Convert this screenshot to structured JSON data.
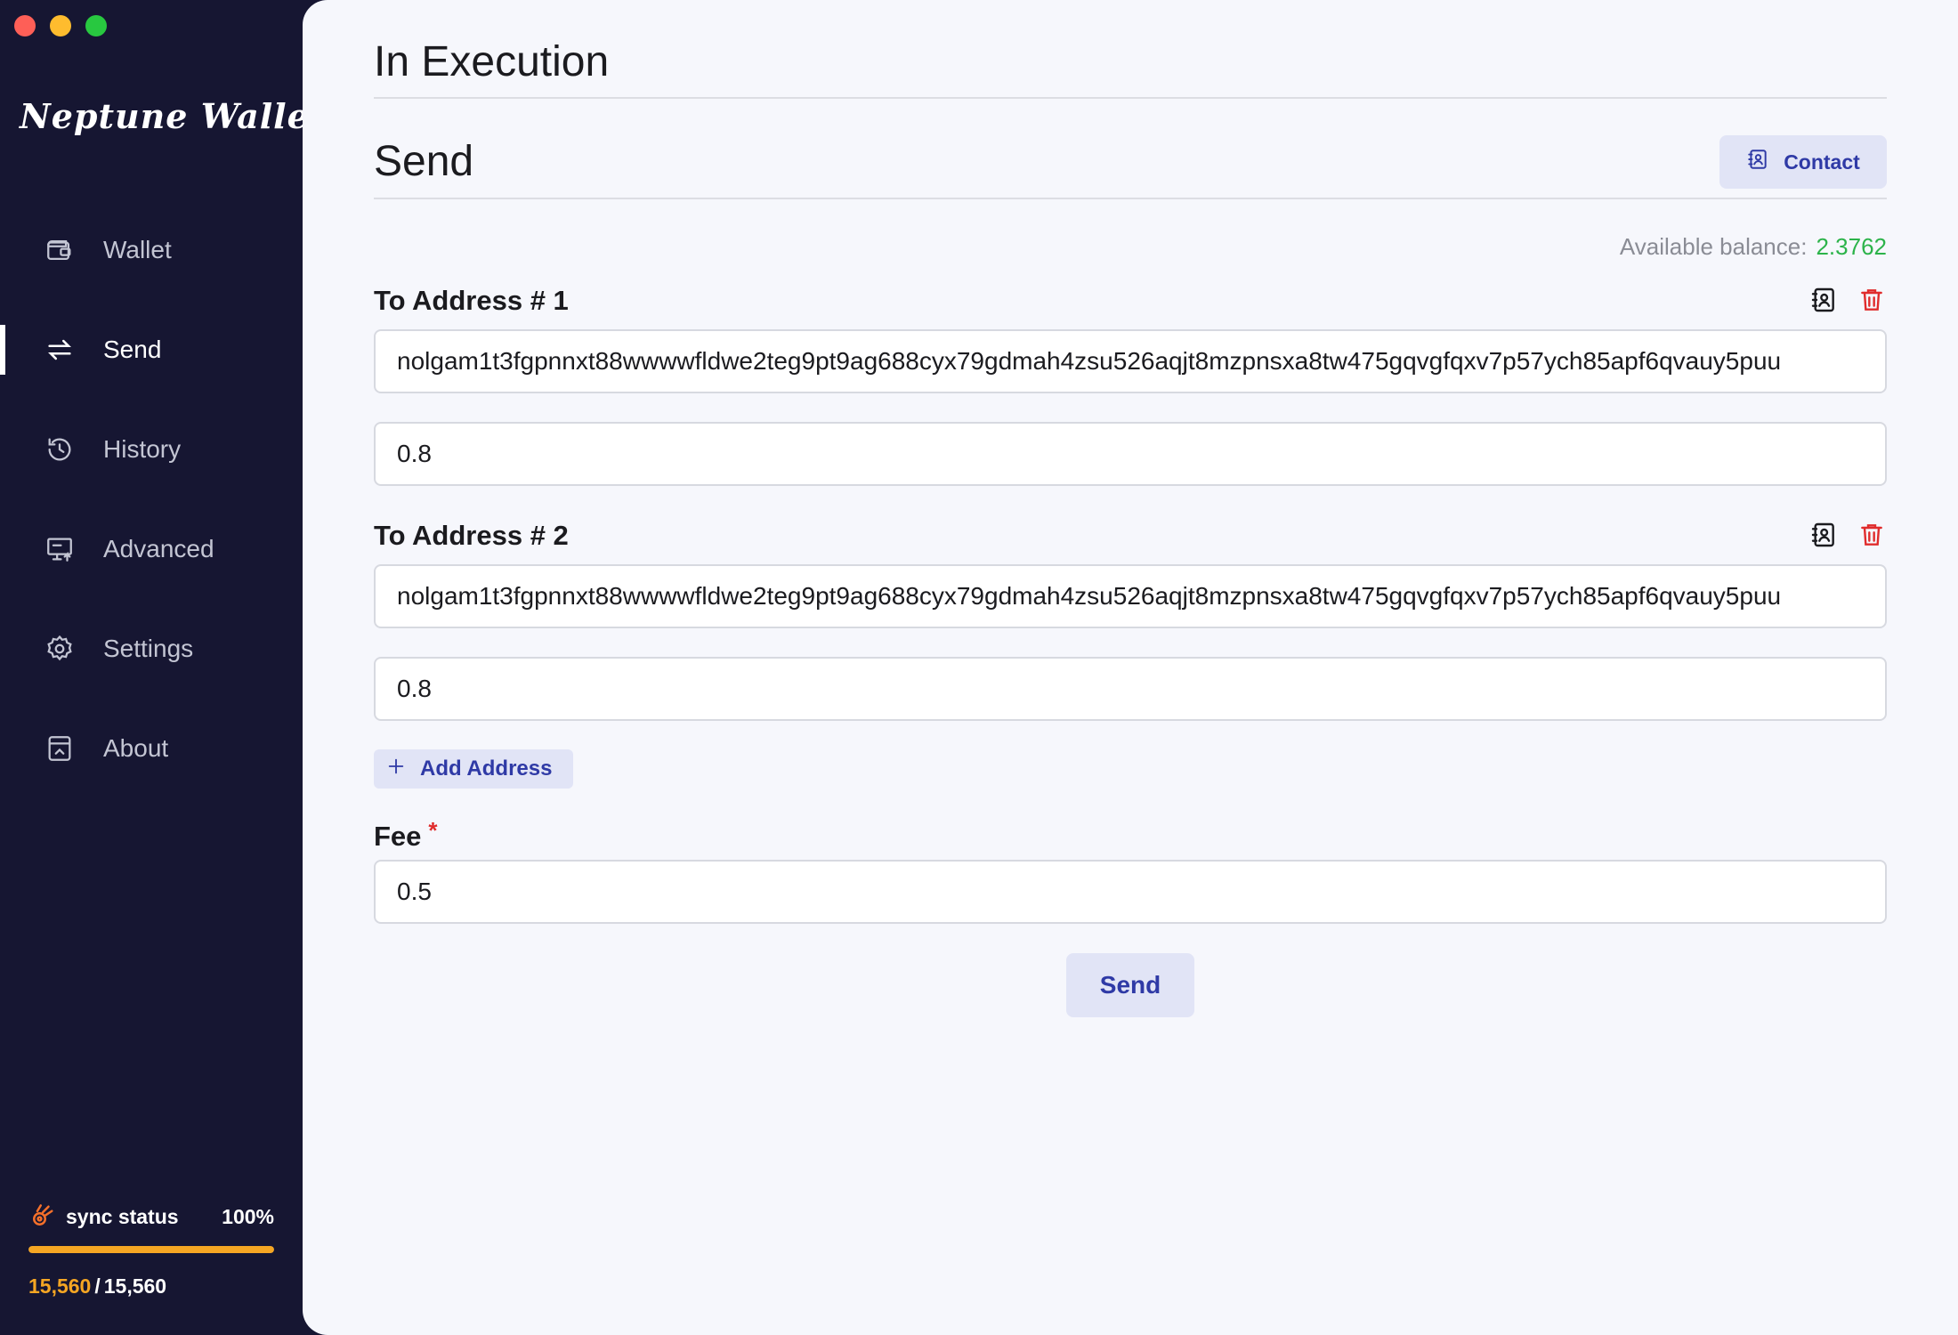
{
  "app": {
    "logo": "Neptune Wallet"
  },
  "sidebar": {
    "items": [
      {
        "label": "Wallet",
        "icon": "wallet-icon"
      },
      {
        "label": "Send",
        "icon": "send-icon",
        "active": true
      },
      {
        "label": "History",
        "icon": "history-icon"
      },
      {
        "label": "Advanced",
        "icon": "advanced-icon"
      },
      {
        "label": "Settings",
        "icon": "gear-icon"
      },
      {
        "label": "About",
        "icon": "about-icon"
      }
    ],
    "sync": {
      "label": "sync status",
      "percent_text": "100%",
      "progress": 1.0,
      "current": "15,560",
      "separator": "/",
      "total": "15,560"
    }
  },
  "main": {
    "page_title": "In Execution",
    "section_title": "Send",
    "contact_label": "Contact",
    "balance_label": "Available balance:",
    "balance_value": "2.3762",
    "recipients": [
      {
        "label": "To Address # 1",
        "address": "nolgam1t3fgpnnxt88wwwwfldwe2teg9pt9ag688cyx79gdmah4zsu526aqjt8mzpnsxa8tw475gqvgfqxv7p57ych85apf6qvauy5puu",
        "amount": "0.8"
      },
      {
        "label": "To Address # 2",
        "address": "nolgam1t3fgpnnxt88wwwwfldwe2teg9pt9ag688cyx79gdmah4zsu526aqjt8mzpnsxa8tw475gqvgfqxv7p57ych85apf6qvauy5puu",
        "amount": "0.8"
      }
    ],
    "add_address_label": "Add Address",
    "fee_label": "Fee",
    "fee_required_mark": "*",
    "fee_value": "0.5",
    "send_label": "Send"
  },
  "colors": {
    "sidebar_bg": "#161632",
    "main_bg": "#f6f7fc",
    "accent": "#2f3aa6",
    "button_bg": "#e1e4f6",
    "balance_green": "#2cb34a",
    "danger_red": "#e02c2c",
    "sync_orange": "#f5a623"
  }
}
